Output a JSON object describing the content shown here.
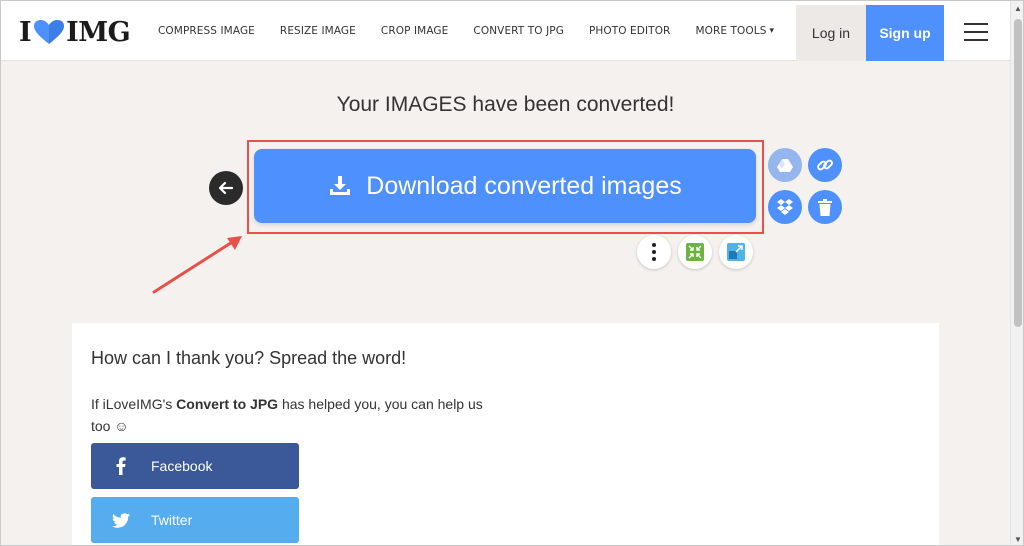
{
  "header": {
    "logo_prefix": "I",
    "logo_suffix": "IMG",
    "nav": [
      {
        "label": "COMPRESS IMAGE"
      },
      {
        "label": "RESIZE IMAGE"
      },
      {
        "label": "CROP IMAGE"
      },
      {
        "label": "CONVERT TO JPG"
      },
      {
        "label": "PHOTO EDITOR"
      },
      {
        "label": "MORE TOOLS",
        "caret": "▾"
      }
    ],
    "login_label": "Log in",
    "signup_label": "Sign up"
  },
  "main": {
    "title": "Your IMAGES have been converted!",
    "download_label": "Download converted images"
  },
  "share": {
    "title": "How can I thank you? Spread the word!",
    "text_prefix": "If iLoveIMG's ",
    "text_bold": "Convert to JPG",
    "text_suffix": " has helped you, you can help us too ☺",
    "facebook_label": "Facebook",
    "twitter_label": "Twitter"
  },
  "colors": {
    "accent": "#4d90fe",
    "page_bg": "#f4f1ee",
    "annotation": "#e8504a",
    "facebook": "#3b5998",
    "twitter": "#55acee"
  },
  "icons": [
    "heart-logo-icon",
    "chevron-down-icon",
    "hamburger-icon",
    "arrow-left-icon",
    "download-icon",
    "google-drive-icon",
    "link-icon",
    "dropbox-icon",
    "trash-icon",
    "more-vertical-icon",
    "compress-icon",
    "resize-icon",
    "facebook-icon",
    "twitter-icon"
  ]
}
